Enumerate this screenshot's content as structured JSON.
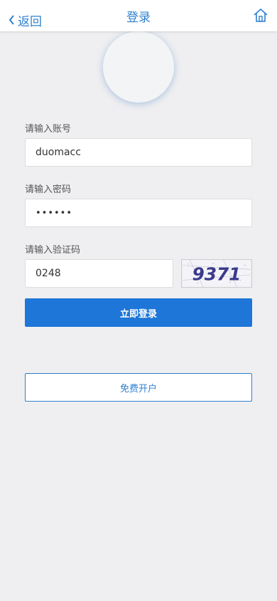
{
  "header": {
    "back_label": "返回",
    "title": "登录",
    "back_icon": "chevron-left-icon",
    "home_icon": "home-icon"
  },
  "form": {
    "account_label": "请输入账号",
    "account_value": "duomacc",
    "password_label": "请输入密码",
    "password_value": "••••••",
    "code_label": "请输入验证码",
    "code_value": "0248",
    "captcha_text": "9371"
  },
  "buttons": {
    "login": "立即登录",
    "register": "免费开户"
  },
  "colors": {
    "accent": "#2f7fcf",
    "primary_button": "#1e76d8",
    "background": "#efeff1"
  }
}
